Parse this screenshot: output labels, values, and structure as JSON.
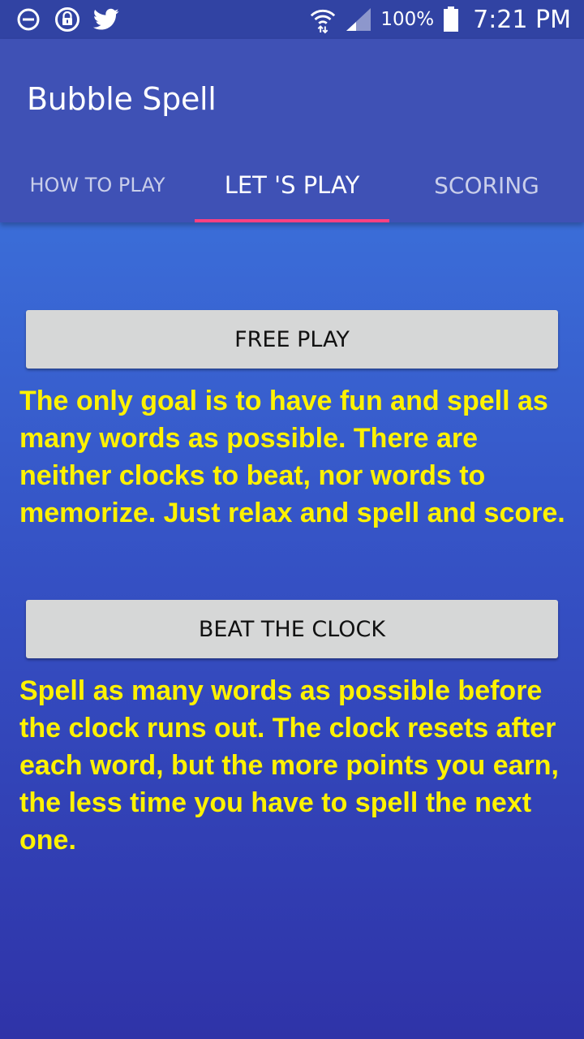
{
  "status_bar": {
    "left_icons": [
      "do-not-disturb-icon",
      "lock-icon",
      "twitter-icon"
    ],
    "right_icons": [
      "wifi-icon",
      "cell-signal-icon",
      "battery-icon"
    ],
    "battery_percent": "100%",
    "time": "7:21 PM"
  },
  "app_bar": {
    "title": "Bubble Spell",
    "tabs": [
      {
        "label": "HOW TO PLAY",
        "active": false
      },
      {
        "label": "LET 'S PLAY",
        "active": true
      },
      {
        "label": "SCORING",
        "active": false
      }
    ]
  },
  "modes": {
    "free_play": {
      "button_label": "FREE PLAY",
      "description": "The only goal is to have fun and spell as many words as possible. There are neither clocks to beat, nor words to memorize. Just relax and spell and score."
    },
    "beat_the_clock": {
      "button_label": "BEAT THE CLOCK",
      "description": "Spell as many words as possible before the clock runs out. The clock resets after each word, but the more points you earn, the less time you have to spell the next one."
    }
  },
  "colors": {
    "status_bar": "#3143a3",
    "app_bar": "#3f51b5",
    "tab_indicator": "#ff4081",
    "description_text": "#fff200",
    "button_bg": "#d6d7d7"
  }
}
